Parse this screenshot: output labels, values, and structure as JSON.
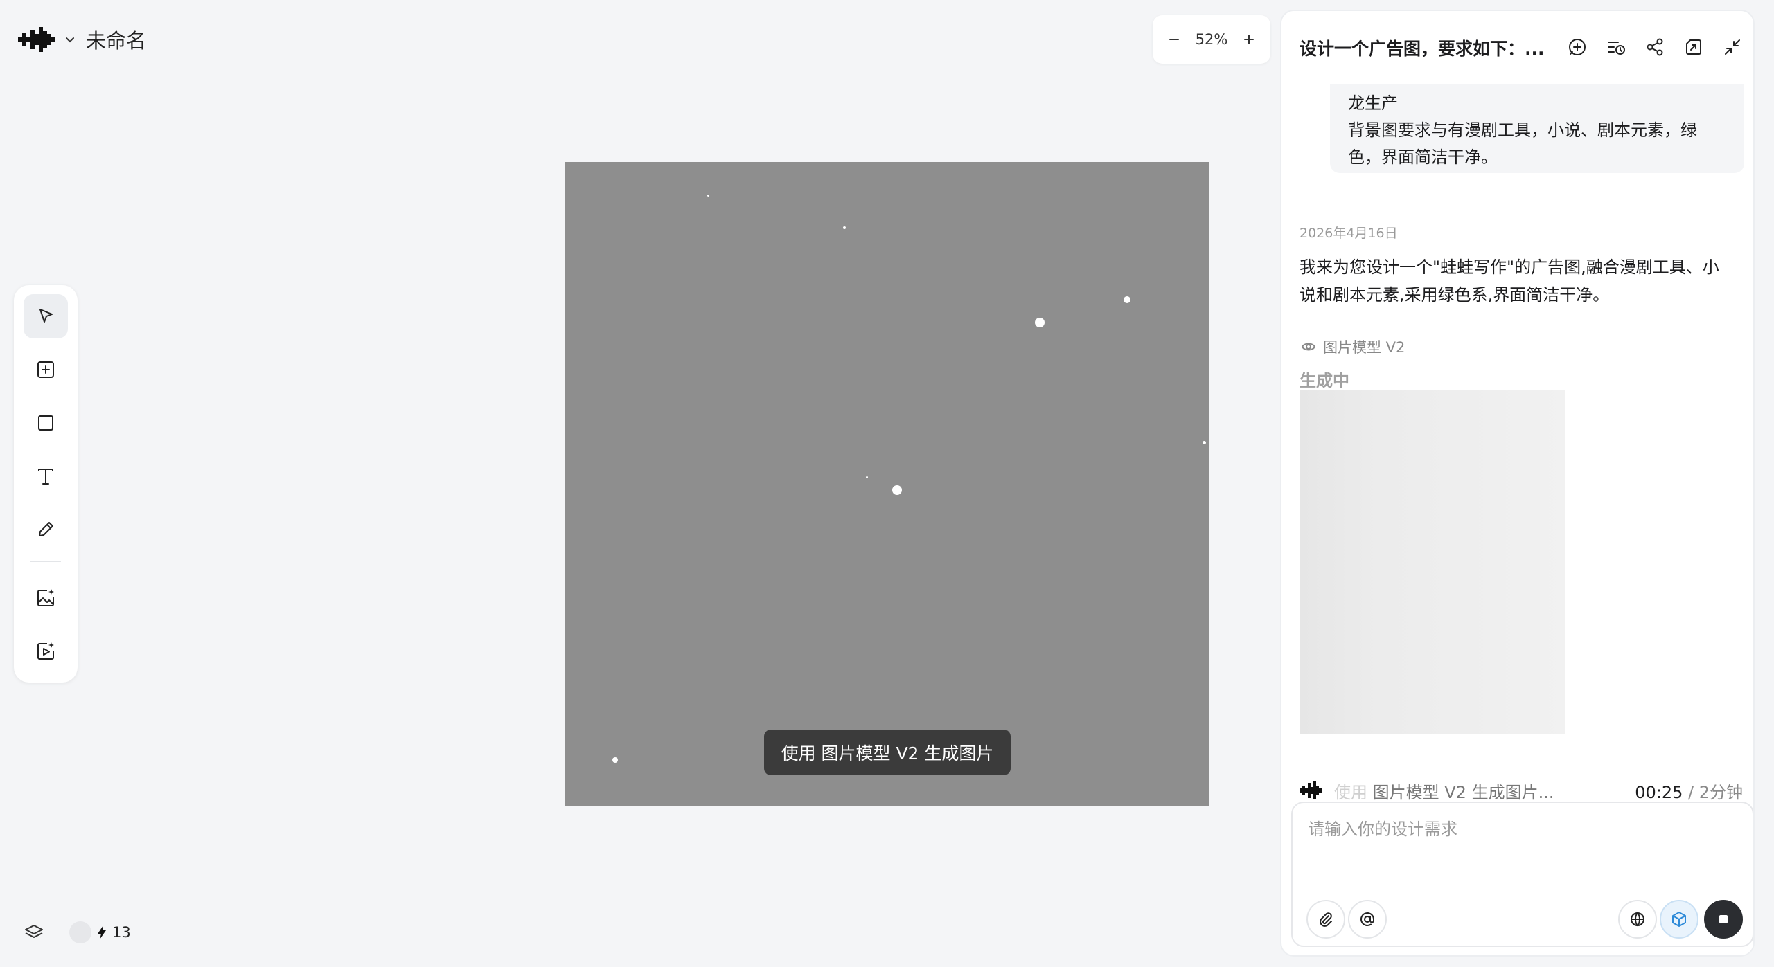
{
  "app": {
    "title": "未命名",
    "logo_icon": "pixel-arrow-logo-icon"
  },
  "zoom": {
    "level": "52%",
    "minus_icon": "minus-icon",
    "plus_icon": "plus-icon"
  },
  "toolbar": {
    "tools": [
      {
        "name": "select",
        "icon": "cursor-arrow-icon",
        "active": true
      },
      {
        "name": "add-frame",
        "icon": "plus-square-icon",
        "active": false
      },
      {
        "name": "rectangle",
        "icon": "square-icon",
        "active": false
      },
      {
        "name": "text",
        "icon": "text-t-icon",
        "active": false
      },
      {
        "name": "pen",
        "icon": "pencil-icon",
        "active": false
      },
      {
        "name": "ai-image",
        "icon": "image-sparkle-icon",
        "active": false
      },
      {
        "name": "ai-video",
        "icon": "video-play-icon",
        "active": false
      }
    ]
  },
  "canvas": {
    "background": "#8e8e8e",
    "toast": "使用 图片模型 V2 生成图片"
  },
  "status": {
    "credits": "13"
  },
  "panel": {
    "title": "设计一个广告图，要求如下：...",
    "user_message": {
      "line1": "龙生产",
      "line2": "背景图要求与有漫剧工具，小说、剧本元素，绿色，界面简洁干净。"
    },
    "date": "2026年4月16日",
    "reply": "我来为您设计一个\"蛙蛙写作\"的广告图,融合漫剧工具、小说和剧本元素,采用绿色系,界面简洁干净。",
    "model_label": "图片模型 V2",
    "gen_status": "生成中",
    "progress": {
      "faded_prefix": "使用",
      "text": "图片模型 V2 生成图片...",
      "elapsed": "00:25",
      "estimate": "/ 2分钟"
    },
    "input": {
      "placeholder": "请输入你的设计需求"
    }
  }
}
